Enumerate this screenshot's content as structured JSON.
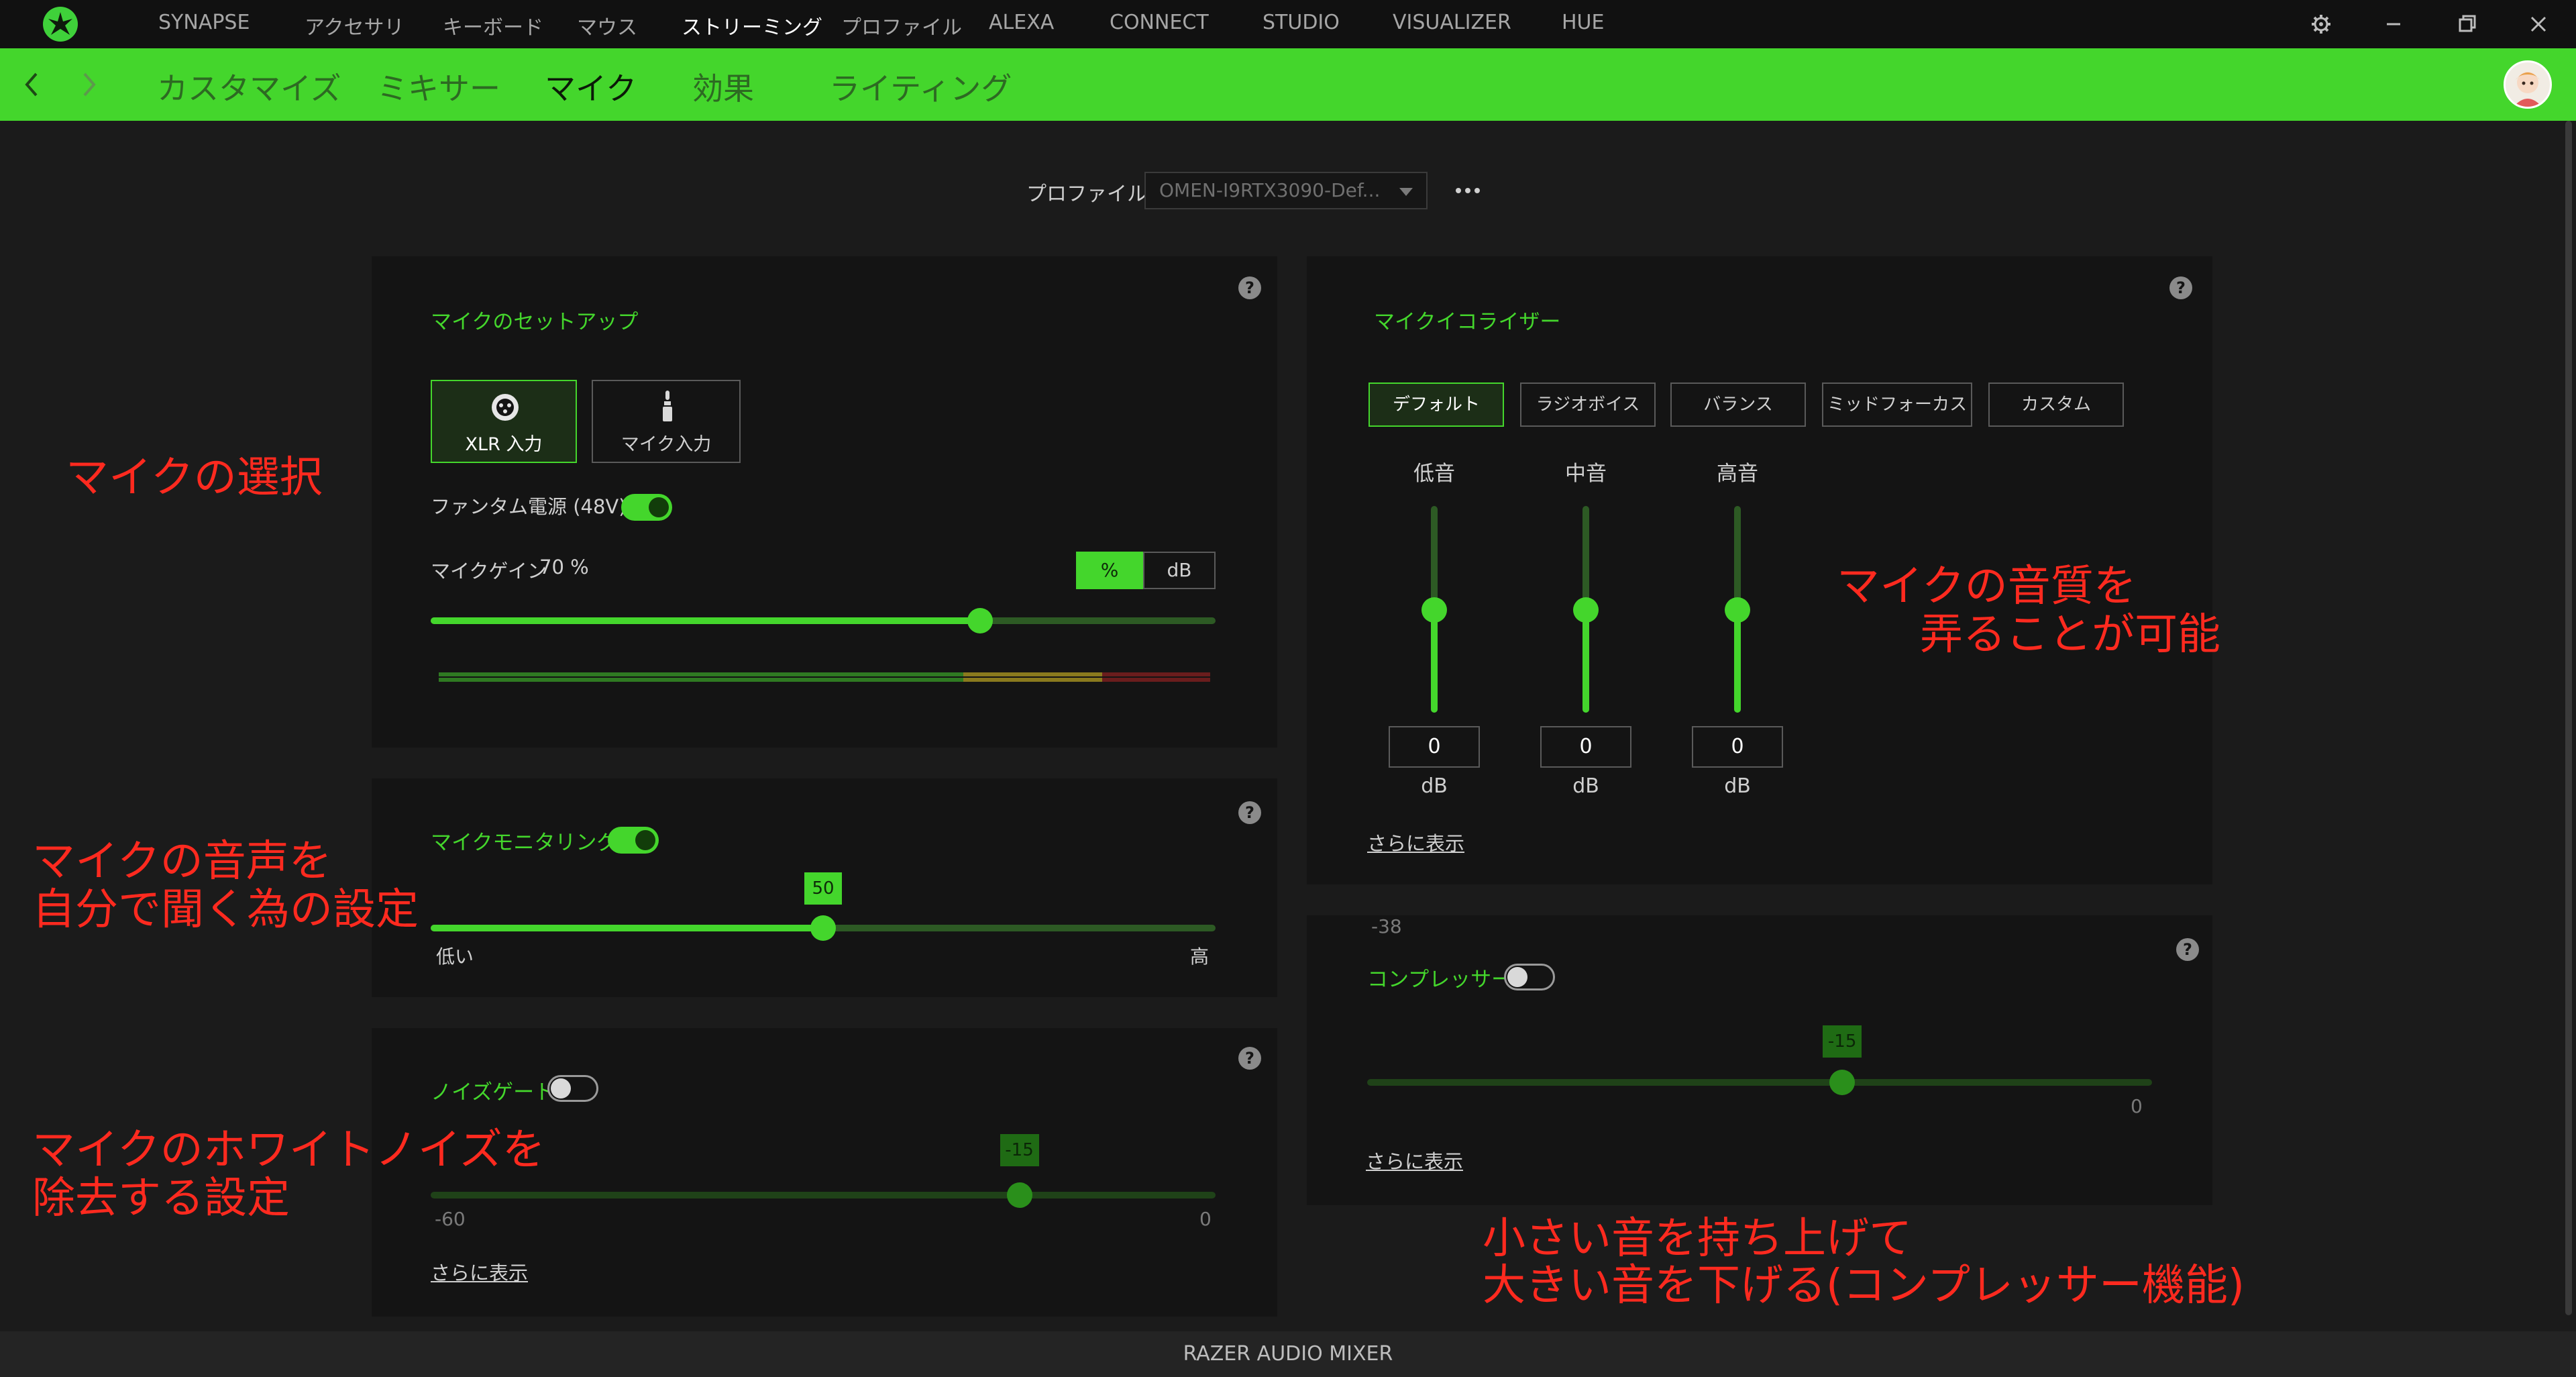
{
  "topbar": {
    "nav": [
      "SYNAPSE",
      "アクセサリ",
      "キーボード",
      "マウス",
      "ストリーミング",
      "プロファイル",
      "ALEXA",
      "CONNECT",
      "STUDIO",
      "VISUALIZER",
      "HUE"
    ],
    "active_nav": "ストリーミング",
    "icons": [
      "razer-logo-icon",
      "gear-icon",
      "minimize-icon",
      "restore-icon",
      "close-icon"
    ]
  },
  "subnav": {
    "tabs": [
      "カスタマイズ",
      "ミキサー",
      "マイク",
      "効果",
      "ライティング"
    ],
    "active_tab": "マイク",
    "icons": [
      "back-arrow-icon",
      "forward-arrow-icon",
      "avatar"
    ]
  },
  "profile": {
    "label": "プロファイル",
    "selected": "OMEN-I9RTX3090-Def..."
  },
  "mic_setup": {
    "title": "マイクのセットアップ",
    "buttons": [
      {
        "label": "XLR 入力",
        "icon": "xlr-connector-icon",
        "active": true
      },
      {
        "label": "マイク入力",
        "icon": "mic-jack-icon",
        "active": false
      }
    ],
    "phantom_power_label": "ファンタム電源 (48V)",
    "phantom_power_on": true,
    "gain_label": "マイクゲイン",
    "gain_value": "70 %",
    "gain_fraction": 0.7,
    "unit_buttons": [
      "%",
      "dB"
    ],
    "unit_active": "%",
    "level_meter": {
      "green_fraction": 0.68,
      "yellow_fraction": 0.18,
      "red_fraction": 0.14
    }
  },
  "monitoring": {
    "title": "マイクモニタリング",
    "enabled": true,
    "value": "50",
    "fraction": 0.5,
    "min_label": "低い",
    "max_label": "高"
  },
  "noise_gate": {
    "title": "ノイズゲート",
    "enabled": false,
    "value": "-15",
    "min": -60,
    "max": 0,
    "min_label": "-60",
    "max_label": "0",
    "more_link": "さらに表示"
  },
  "equalizer": {
    "title": "マイクイコライザー",
    "presets": [
      "デフォルト",
      "ラジオボイス",
      "バランス",
      "ミッドフォーカス",
      "カスタム"
    ],
    "active_preset": "デフォルト",
    "bands": [
      {
        "label": "低音",
        "value": "0",
        "unit": "dB"
      },
      {
        "label": "中音",
        "value": "0",
        "unit": "dB"
      },
      {
        "label": "高音",
        "value": "0",
        "unit": "dB"
      }
    ],
    "more_link": "さらに表示"
  },
  "compressor": {
    "title": "コンプレッサー",
    "enabled": false,
    "value": "-15",
    "min": -38,
    "max": 0,
    "min_label": "-38",
    "max_label": "0",
    "more_link": "さらに表示"
  },
  "annotations": {
    "mic_select": "マイクの選択",
    "monitoring_line1": "マイクの音声を",
    "monitoring_line2": "自分で聞く為の設定",
    "noise_line1": "マイクのホワイトノイズを",
    "noise_line2": "除去する設定",
    "eq_line1": "マイクの音質を",
    "eq_line2": "弄ることが可能",
    "comp_line1": "小さい音を持ち上げて",
    "comp_line2": "大きい音を下げる(コンプレッサー機能)"
  },
  "footer": {
    "title": "RAZER AUDIO MIXER"
  },
  "colors": {
    "accent": "#44d62c",
    "background": "#1b1b1b",
    "panel": "#141414",
    "annotation": "#ff2a1f"
  }
}
